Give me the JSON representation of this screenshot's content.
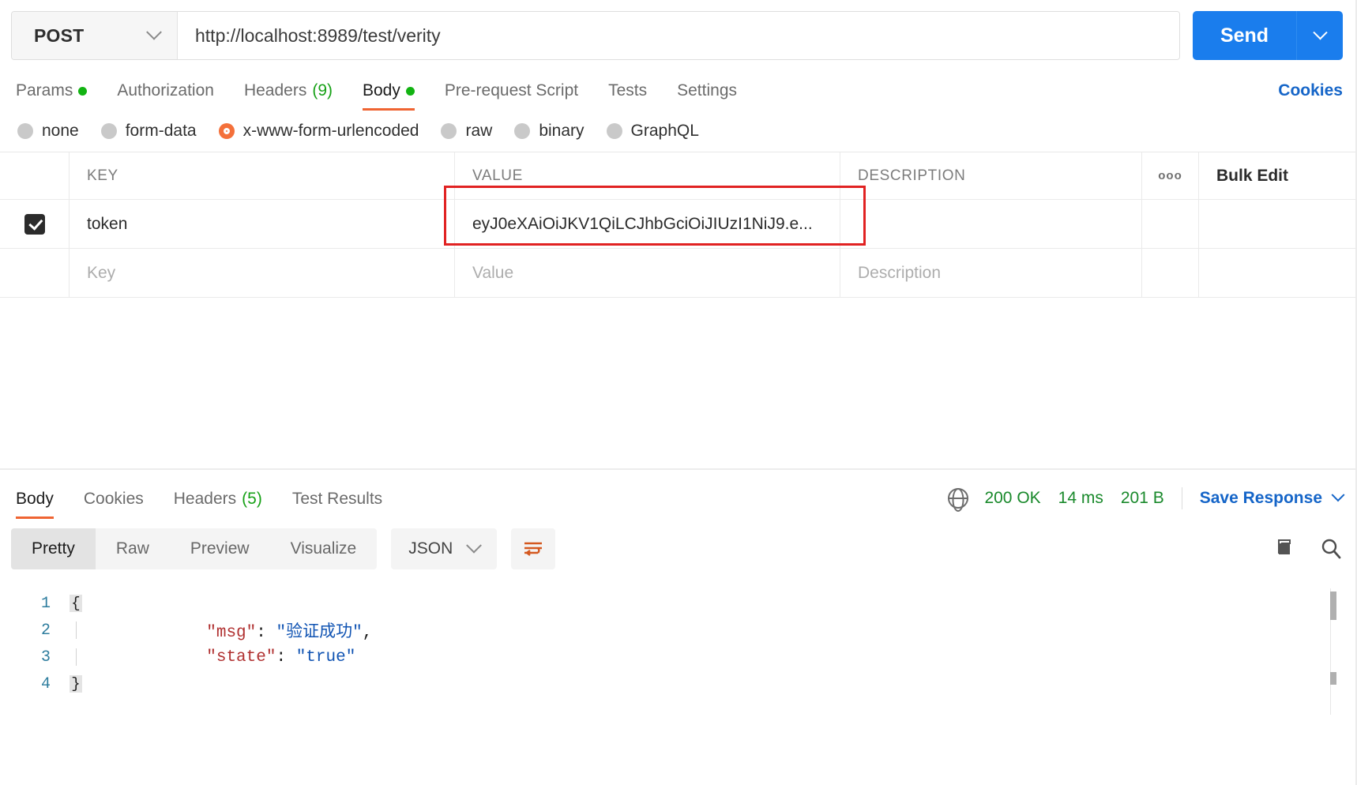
{
  "request": {
    "method": "POST",
    "method_icon": "chevron-down-icon",
    "url": "http://localhost:8989/test/verity",
    "send_label": "Send",
    "send_caret_icon": "chevron-down-icon",
    "tabs": [
      {
        "label": "Params",
        "badge": "",
        "dot": true,
        "active": false
      },
      {
        "label": "Authorization",
        "badge": "",
        "dot": false,
        "active": false
      },
      {
        "label": "Headers",
        "badge": "(9)",
        "dot": false,
        "active": false
      },
      {
        "label": "Body",
        "badge": "",
        "dot": true,
        "active": true
      },
      {
        "label": "Pre-request Script",
        "badge": "",
        "dot": false,
        "active": false
      },
      {
        "label": "Tests",
        "badge": "",
        "dot": false,
        "active": false
      },
      {
        "label": "Settings",
        "badge": "",
        "dot": false,
        "active": false
      }
    ],
    "cookies_link": "Cookies",
    "body_types": [
      {
        "label": "none",
        "selected": false
      },
      {
        "label": "form-data",
        "selected": false
      },
      {
        "label": "x-www-form-urlencoded",
        "selected": true
      },
      {
        "label": "raw",
        "selected": false
      },
      {
        "label": "binary",
        "selected": false
      },
      {
        "label": "GraphQL",
        "selected": false
      }
    ],
    "table": {
      "headers": {
        "key": "KEY",
        "value": "VALUE",
        "description": "DESCRIPTION",
        "more_icon": "ooo",
        "bulk_edit": "Bulk Edit"
      },
      "rows": [
        {
          "checked": true,
          "key": "token",
          "value": "eyJ0eXAiOiJKV1QiLCJhbGciOiJIUzI1NiJ9.e...",
          "description": "",
          "highlighted": true
        }
      ],
      "placeholders": {
        "key": "Key",
        "value": "Value",
        "description": "Description"
      }
    }
  },
  "response": {
    "tabs": [
      {
        "label": "Body",
        "badge": "",
        "active": true
      },
      {
        "label": "Cookies",
        "badge": "",
        "active": false
      },
      {
        "label": "Headers",
        "badge": "(5)",
        "active": false
      },
      {
        "label": "Test Results",
        "badge": "",
        "active": false
      }
    ],
    "network_icon": "globe-icon",
    "status": "200 OK",
    "time": "14 ms",
    "size": "201 B",
    "save_response": "Save Response",
    "save_caret_icon": "chevron-down-icon",
    "view_modes": [
      {
        "label": "Pretty",
        "active": true
      },
      {
        "label": "Raw",
        "active": false
      },
      {
        "label": "Preview",
        "active": false
      },
      {
        "label": "Visualize",
        "active": false
      }
    ],
    "format": "JSON",
    "format_caret_icon": "chevron-down-icon",
    "wrap_icon": "wrap-lines-icon",
    "copy_icon": "copy-icon",
    "search_icon": "search-icon",
    "code_lines": [
      {
        "n": "1",
        "fold": "{",
        "indent": 0,
        "key": "",
        "colon": "",
        "value": "",
        "comma": ""
      },
      {
        "n": "2",
        "fold": "",
        "indent": 1,
        "key": "\"msg\"",
        "colon": ": ",
        "value": "\"验证成功\"",
        "comma": ","
      },
      {
        "n": "3",
        "fold": "",
        "indent": 1,
        "key": "\"state\"",
        "colon": ": ",
        "value": "\"true\"",
        "comma": ""
      },
      {
        "n": "4",
        "fold": "}",
        "indent": 0,
        "key": "",
        "colon": "",
        "value": "",
        "comma": ""
      }
    ]
  },
  "colors": {
    "accent_orange": "#ef6432",
    "send_blue": "#1a7ded",
    "link_blue": "#1565c8",
    "status_green": "#19892b",
    "dot_green": "#12b312",
    "highlight_red": "#e12222",
    "json_key_red": "#b03030",
    "json_value_blue": "#1154b3",
    "gutter_blue": "#2e7d9e"
  }
}
